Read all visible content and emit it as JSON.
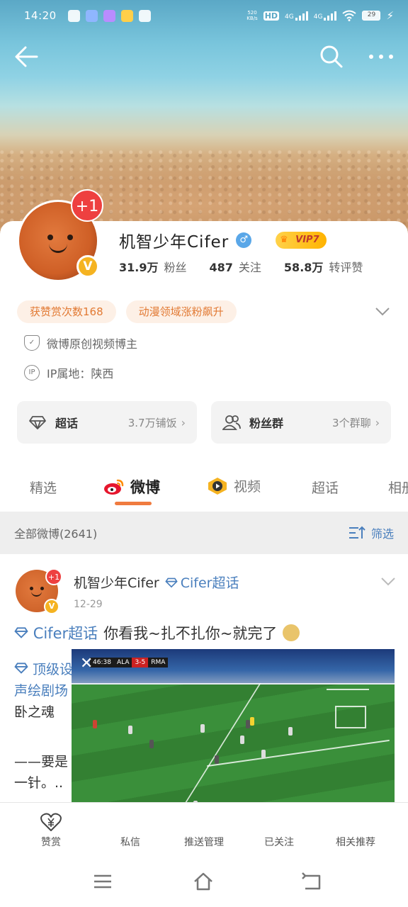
{
  "status_bar": {
    "time": "14:20",
    "net_speed": "520\nKB/s",
    "hd": "HD",
    "signal1": "4G",
    "signal2": "4G",
    "battery": "29"
  },
  "profile": {
    "name": "机智少年Cifer",
    "badge_count": "+1",
    "vip": "VIP7",
    "stats": [
      {
        "num": "31.9万",
        "label": "粉丝"
      },
      {
        "num": "487",
        "label": "关注"
      },
      {
        "num": "58.8万",
        "label": "转评赞"
      }
    ],
    "tags": [
      "获赞赏次数168",
      "动漫领域涨粉飙升"
    ],
    "info": [
      {
        "icon": "shield-check-icon",
        "text": "微博原创视频博主"
      },
      {
        "icon": "ip-icon",
        "text": "IP属地：陕西"
      }
    ],
    "cards": [
      {
        "title": "超话",
        "sub": "3.7万铺饭",
        "icon": "diamond-icon"
      },
      {
        "title": "粉丝群",
        "sub": "3个群聊",
        "icon": "group-icon"
      }
    ]
  },
  "tabs": [
    {
      "label": "精选",
      "active": false
    },
    {
      "label": "微博",
      "active": true
    },
    {
      "label": "视频",
      "active": false
    },
    {
      "label": "超话",
      "active": false
    },
    {
      "label": "相册",
      "active": false
    }
  ],
  "filter": {
    "all": "全部微博(2641)",
    "button": "筛选"
  },
  "post": {
    "author": "机智少年Cifer",
    "badge": "+1",
    "topic": "Cifer超话",
    "date": "12-29",
    "text_topic": "Cifer超话",
    "text": "你看我~扎不扎你~就完了",
    "body_line1": "顶级设",
    "body_line2": "声绘剧场",
    "body_line3": "卧之魂",
    "body_line4": "——要是",
    "body_line5": "一针。.."
  },
  "video": {
    "time": "46:38",
    "home": "ALA",
    "score": "3-5",
    "away": "RMA",
    "close": "✕"
  },
  "actions": [
    {
      "label": "赞赏",
      "icon": "yen-heart-icon"
    },
    {
      "label": "私信",
      "icon": "message-icon"
    },
    {
      "label": "推送管理",
      "icon": "push-icon"
    },
    {
      "label": "已关注",
      "icon": "followed-icon"
    },
    {
      "label": "相关推荐",
      "icon": "recommend-icon"
    }
  ],
  "colors": {
    "accent_orange": "#f07b3f",
    "link_blue": "#4a7fbd",
    "badge_red": "#ee4040",
    "vip_gold": "#ffb300"
  }
}
